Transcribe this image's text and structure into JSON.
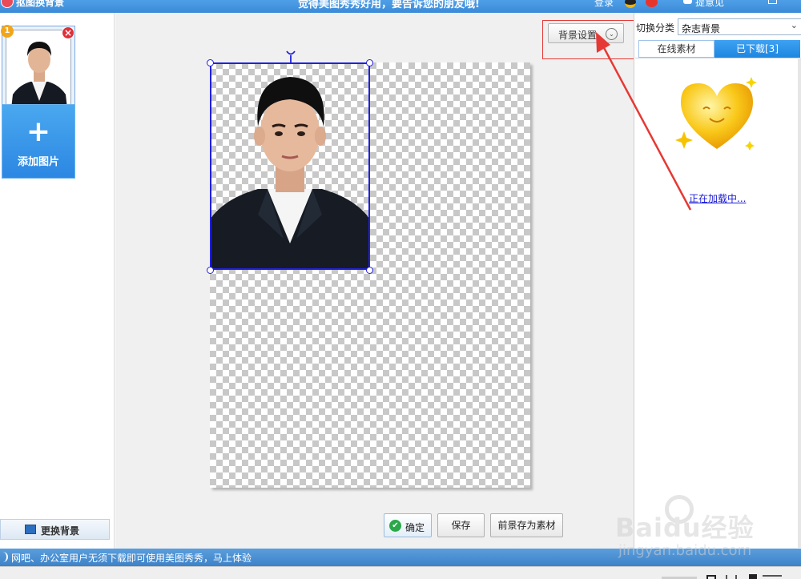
{
  "titlebar": {
    "app_title": "抠图换背景",
    "slogan": "觉得美图秀秀好用，要告诉您的朋友哦!",
    "login": "登录",
    "feedback": "提意见"
  },
  "left_panel": {
    "thumb_badge": "1",
    "thumb_delete": "×",
    "add_image_plus": "+",
    "add_image_label": "添加图片",
    "change_bg_label": "更换背景"
  },
  "canvas": {
    "bg_settings_label": "背景设置",
    "bg_settings_chevron": "⌄",
    "confirm_icon": "✔",
    "confirm_label": "确定",
    "save_label": "保存",
    "save_as_material_label": "前景存为素材"
  },
  "right_panel": {
    "category_label": "切换分类",
    "category_value": "杂志背景",
    "category_arrow": "⌄",
    "tab_online": "在线素材",
    "tab_downloaded": "已下载[3]",
    "loading_text": "正在加载中..."
  },
  "statusbar": {
    "message": "网吧、办公室用户无须下载即可使用美图秀秀，马上体验"
  },
  "watermark": {
    "logo": "Baidu经验",
    "url": "jingyan.baidu.com"
  },
  "colors": {
    "accent_blue": "#3a8ad8",
    "selection_blue": "#2020e0",
    "annotation_red": "#e53935",
    "link_blue": "#1a1ad8",
    "heart_gold": "#f7b800"
  },
  "icons": {
    "app_logo": "meitu-logo-icon",
    "qq": "qq-penguin-icon",
    "weibo": "weibo-icon",
    "feedback": "speech-bubble-icon",
    "confirm": "check-circle-icon",
    "change_bg": "picture-icon",
    "status": "speaker-icon"
  }
}
